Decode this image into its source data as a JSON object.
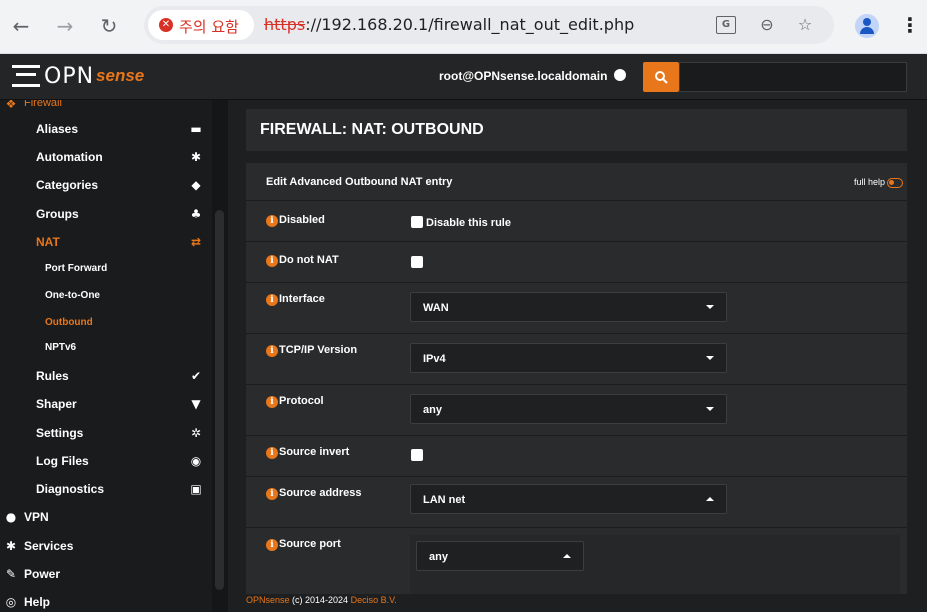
{
  "browser": {
    "security_label": "주의 요함",
    "url_scheme": "https",
    "url_rest": "://192.168.20.1/firewall_nat_out_edit.php"
  },
  "header": {
    "logo_text": "OPN",
    "logo_sense": "sense",
    "user": "root@OPNsense.localdomain"
  },
  "sidebar": {
    "top_partial": "Firewall",
    "items": [
      {
        "label": "Aliases",
        "icon": "list-icon",
        "glyph": "▬"
      },
      {
        "label": "Automation",
        "icon": "cog-icon",
        "glyph": "✱"
      },
      {
        "label": "Categories",
        "icon": "tag-icon",
        "glyph": "◆"
      },
      {
        "label": "Groups",
        "icon": "sitemap-icon",
        "glyph": "♣"
      },
      {
        "label": "NAT",
        "icon": "exchange-icon",
        "glyph": "⇄"
      },
      {
        "label": "Port Forward"
      },
      {
        "label": "One-to-One"
      },
      {
        "label": "Outbound"
      },
      {
        "label": "NPTv6"
      },
      {
        "label": "Rules",
        "icon": "check-icon",
        "glyph": "✔"
      },
      {
        "label": "Shaper",
        "icon": "filter-icon",
        "glyph": "▼"
      },
      {
        "label": "Settings",
        "icon": "cogs-icon",
        "glyph": "✲"
      },
      {
        "label": "Log Files",
        "icon": "eye-icon",
        "glyph": "◉"
      },
      {
        "label": "Diagnostics",
        "icon": "camera-icon",
        "glyph": "▣"
      },
      {
        "label": "VPN",
        "icon": "globe-icon",
        "glyph": "●"
      },
      {
        "label": "Services",
        "icon": "cog-icon",
        "glyph": "✱"
      },
      {
        "label": "Power",
        "icon": "plug-icon",
        "glyph": "✎"
      },
      {
        "label": "Help",
        "icon": "help-icon",
        "glyph": "◎"
      }
    ]
  },
  "page": {
    "title": "FIREWALL: NAT: OUTBOUND",
    "form_title": "Edit Advanced Outbound NAT entry",
    "full_help": "full help",
    "rows": {
      "disabled": {
        "label": "Disabled",
        "checkbox_label": "Disable this rule"
      },
      "donotnat": {
        "label": "Do not NAT"
      },
      "interface": {
        "label": "Interface",
        "value": "WAN"
      },
      "ipversion": {
        "label": "TCP/IP Version",
        "value": "IPv4"
      },
      "protocol": {
        "label": "Protocol",
        "value": "any"
      },
      "srcinvert": {
        "label": "Source invert"
      },
      "srcaddr": {
        "label": "Source address",
        "value": "LAN net"
      },
      "srcport": {
        "label": "Source port",
        "value": "any"
      }
    },
    "footer_brand": "OPNsense",
    "footer_mid": " (c) 2014-2024 ",
    "footer_company": "Deciso B.V."
  },
  "colors": {
    "accent": "#e8761a",
    "background": "#1e1f21"
  }
}
